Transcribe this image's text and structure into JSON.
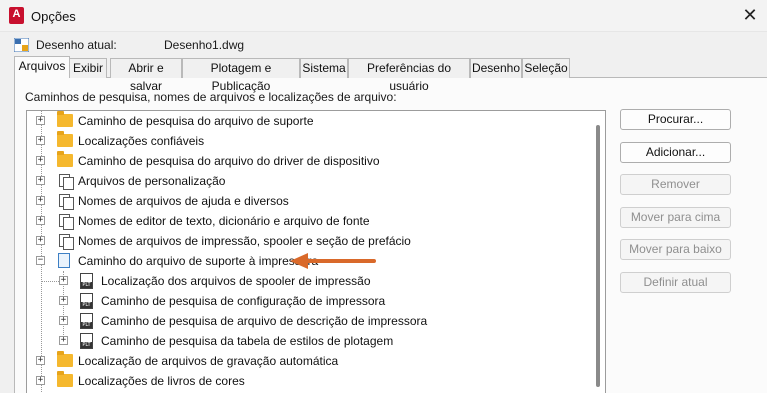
{
  "window": {
    "title": "Opções",
    "app_icon_letter": "A",
    "close_glyph": "✕"
  },
  "drawing": {
    "label": "Desenho atual:",
    "value": "Desenho1.dwg"
  },
  "tabs": [
    {
      "label": "Arquivos",
      "active": true
    },
    {
      "label": "Exibir"
    },
    {
      "label": "Abrir e salvar"
    },
    {
      "label": "Plotagem e Publicação"
    },
    {
      "label": "Sistema"
    },
    {
      "label": "Preferências do usuário"
    },
    {
      "label": "Desenho"
    },
    {
      "label": "Seleção"
    }
  ],
  "section_label": "Caminhos de pesquisa, nomes de arquivos e localizações de arquivo:",
  "tree": [
    {
      "label": "Caminho de pesquisa do arquivo de suporte",
      "icon": "folder-icon",
      "expander": "+"
    },
    {
      "label": "Localizações confiáveis",
      "icon": "folder-icon",
      "expander": "+"
    },
    {
      "label": "Caminho de pesquisa do arquivo do driver de dispositivo",
      "icon": "folder-icon",
      "expander": "+"
    },
    {
      "label": "Arquivos de personalização",
      "icon": "pages-icon",
      "expander": "+"
    },
    {
      "label": "Nomes de arquivos de ajuda e diversos",
      "icon": "pages-icon",
      "expander": "+"
    },
    {
      "label": "Nomes de editor de texto, dicionário e arquivo de fonte",
      "icon": "pages-icon",
      "expander": "+"
    },
    {
      "label": "Nomes de arquivos de impressão, spooler e seção de prefácio",
      "icon": "pages-icon",
      "expander": "+"
    },
    {
      "label": "Caminho do arquivo de suporte à impressora",
      "icon": "document-icon",
      "expander": "−"
    },
    {
      "label": "Localização dos arquivos de spooler de impressão",
      "icon": "plt-file-icon",
      "expander": "+"
    },
    {
      "label": "Caminho de pesquisa de configuração de impressora",
      "icon": "plt-file-icon",
      "expander": "+"
    },
    {
      "label": "Caminho de pesquisa de arquivo de descrição de impressora",
      "icon": "plt-file-icon",
      "expander": "+"
    },
    {
      "label": "Caminho de pesquisa da tabela de estilos de plotagem",
      "icon": "plt-file-icon",
      "expander": "+"
    },
    {
      "label": "Localização de arquivos de gravação automática",
      "icon": "folder-icon",
      "expander": "+"
    },
    {
      "label": "Localizações de livros de cores",
      "icon": "folder-icon",
      "expander": "+"
    }
  ],
  "buttons": {
    "browse": "Procurar...",
    "add": "Adicionar...",
    "remove": "Remover",
    "move_up": "Mover para cima",
    "move_down": "Mover para baixo",
    "set_current": "Definir atual"
  },
  "colors": {
    "annotation_arrow": "#d9692a",
    "folder": "#f5b82e",
    "app_icon": "#c8102e"
  }
}
